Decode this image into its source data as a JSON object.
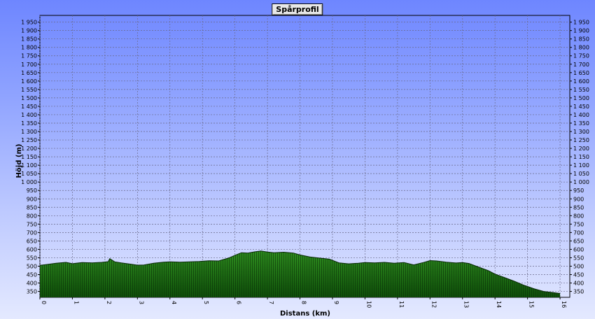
{
  "chart_data": {
    "type": "area",
    "title": "Spårprofil",
    "xlabel": "Distans (km)",
    "ylabel": "Höjd (m)",
    "xlim": [
      0,
      16.3
    ],
    "ylim": [
      315,
      1990
    ],
    "x_ticks": [
      0,
      1,
      2,
      3,
      4,
      5,
      6,
      7,
      8,
      9,
      10,
      11,
      12,
      13,
      14,
      15,
      16
    ],
    "y_ticks": [
      350,
      400,
      450,
      500,
      550,
      600,
      650,
      700,
      750,
      800,
      850,
      900,
      950,
      1000,
      1050,
      1100,
      1150,
      1200,
      1250,
      1300,
      1350,
      1400,
      1450,
      1500,
      1550,
      1600,
      1650,
      1700,
      1750,
      1800,
      1850,
      1900,
      1950
    ],
    "y_tick_labels": [
      "350",
      "400",
      "450",
      "500",
      "550",
      "600",
      "650",
      "700",
      "750",
      "800",
      "850",
      "900",
      "950",
      "1 000",
      "1 050",
      "1 100",
      "1 150",
      "1 200",
      "1 250",
      "1 300",
      "1 350",
      "1 400",
      "1 450",
      "1 500",
      "1 550",
      "1 600",
      "1 650",
      "1 700",
      "1 750",
      "1 800",
      "1 850",
      "1 900",
      "1 950"
    ],
    "grid": true,
    "series": [
      {
        "x": [
          0,
          0.2,
          0.5,
          0.8,
          1.0,
          1.3,
          1.6,
          1.9,
          2.1,
          2.15,
          2.3,
          2.5,
          2.8,
          3.0,
          3.2,
          3.5,
          3.8,
          4.0,
          4.3,
          4.6,
          4.9,
          5.2,
          5.5,
          5.8,
          6.0,
          6.2,
          6.4,
          6.6,
          6.8,
          7.0,
          7.2,
          7.5,
          7.8,
          8.0,
          8.3,
          8.6,
          8.9,
          9.2,
          9.5,
          9.8,
          10.0,
          10.3,
          10.6,
          10.9,
          11.2,
          11.5,
          11.8,
          12.0,
          12.2,
          12.5,
          12.8,
          13.0,
          13.2,
          13.5,
          13.8,
          14.0,
          14.3,
          14.6,
          14.9,
          15.2,
          15.5,
          15.8,
          16.0
        ],
        "y": [
          505,
          510,
          518,
          523,
          515,
          522,
          520,
          523,
          527,
          545,
          526,
          520,
          512,
          506,
          507,
          518,
          524,
          526,
          524,
          526,
          528,
          532,
          531,
          548,
          565,
          580,
          578,
          585,
          590,
          584,
          580,
          583,
          578,
          567,
          555,
          548,
          542,
          520,
          514,
          518,
          522,
          520,
          523,
          518,
          522,
          508,
          522,
          533,
          531,
          524,
          519,
          522,
          516,
          494,
          473,
          453,
          432,
          410,
          386,
          366,
          350,
          343,
          338
        ]
      }
    ]
  }
}
